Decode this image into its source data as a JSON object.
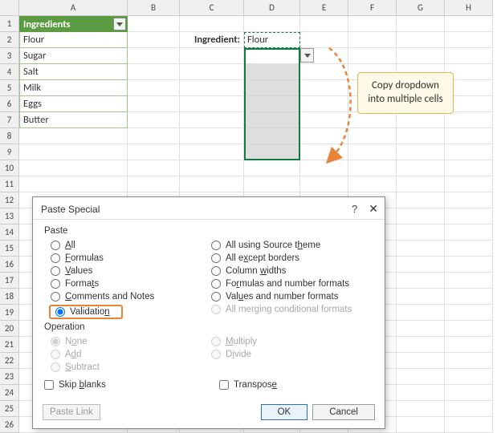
{
  "columns": [
    "A",
    "B",
    "C",
    "D",
    "E",
    "F",
    "G",
    "H"
  ],
  "rowCount": 26,
  "table": {
    "header": "Ingredients",
    "items": [
      "Flour",
      "Sugar",
      "Salt",
      "Milk",
      "Eggs",
      "Butter"
    ]
  },
  "label_c2": "Ingredient:",
  "value_d2": "Flour",
  "callout": "Copy dropdown into multiple cells",
  "dialog": {
    "title": "Paste Special",
    "group_paste": "Paste",
    "group_op": "Operation",
    "left_paste": [
      {
        "key": "all",
        "pre": "",
        "u": "A",
        "post": "ll"
      },
      {
        "key": "formulas",
        "pre": "",
        "u": "F",
        "post": "ormulas"
      },
      {
        "key": "values",
        "pre": "",
        "u": "V",
        "post": "alues"
      },
      {
        "key": "formats",
        "pre": "Forma",
        "u": "t",
        "post": "s"
      },
      {
        "key": "comments",
        "pre": "",
        "u": "C",
        "post": "omments and Notes"
      },
      {
        "key": "validation",
        "pre": "Validatio",
        "u": "n",
        "post": ""
      }
    ],
    "right_paste": [
      {
        "key": "srctheme",
        "pre": "All using Source t",
        "u": "h",
        "post": "eme"
      },
      {
        "key": "exceptborders",
        "pre": "All e",
        "u": "x",
        "post": "cept borders"
      },
      {
        "key": "colwidths",
        "pre": "Column ",
        "u": "w",
        "post": "idths"
      },
      {
        "key": "formnum",
        "pre": "Fo",
        "u": "r",
        "post": "mulas and number formats"
      },
      {
        "key": "valnum",
        "pre": "Val",
        "u": "u",
        "post": "es and number formats"
      },
      {
        "key": "mergecond",
        "pre": "All mer",
        "u": "g",
        "post": "ing conditional formats",
        "disabled": true
      }
    ],
    "left_op": [
      {
        "key": "none",
        "pre": "N",
        "u": "o",
        "post": "ne"
      },
      {
        "key": "add",
        "pre": "A",
        "u": "d",
        "post": "d"
      },
      {
        "key": "subtract",
        "pre": "",
        "u": "S",
        "post": "ubtract"
      }
    ],
    "right_op": [
      {
        "key": "multiply",
        "pre": "",
        "u": "M",
        "post": "ultiply"
      },
      {
        "key": "divide",
        "pre": "D",
        "u": "i",
        "post": "vide"
      }
    ],
    "skip_blanks": {
      "pre": "Skip ",
      "u": "b",
      "post": "lanks"
    },
    "transpose": {
      "pre": "Transpos",
      "u": "e",
      "post": ""
    },
    "paste_link": "Paste Link",
    "ok": "OK",
    "cancel": "Cancel",
    "selected_paste": "validation",
    "selected_op": "none"
  }
}
